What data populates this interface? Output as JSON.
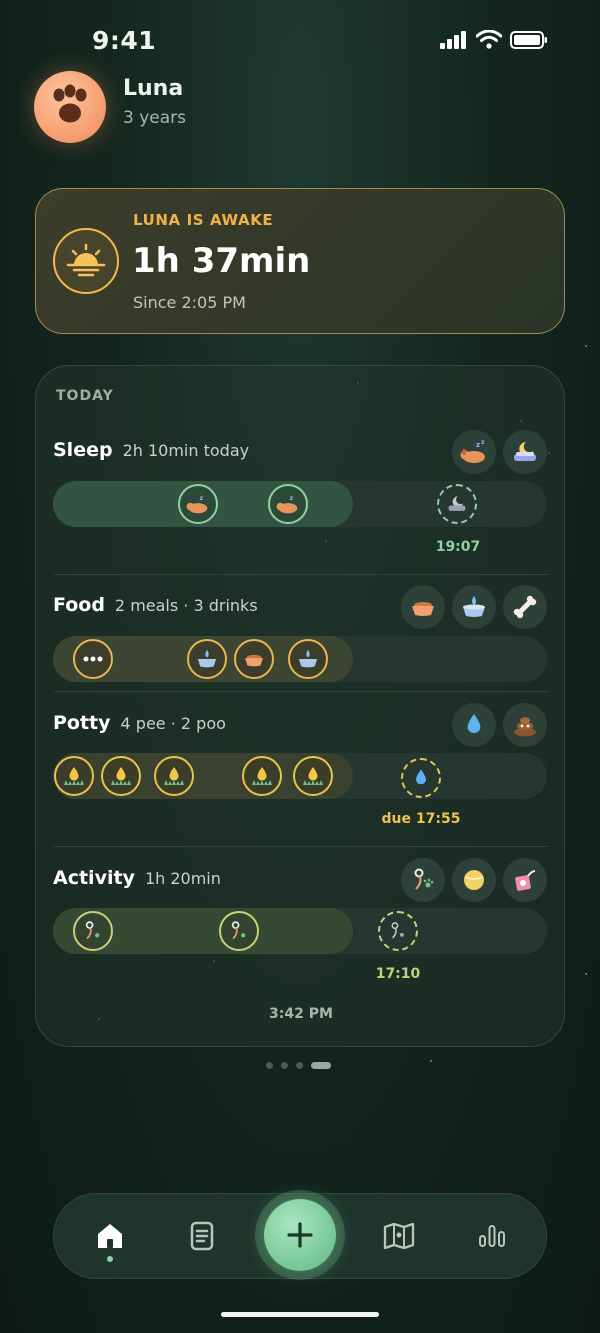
{
  "status_bar": {
    "time": "9:41"
  },
  "profile": {
    "name": "Luna",
    "age": "3 years"
  },
  "awake": {
    "label": "LUNA IS AWAKE",
    "duration": "1h 37min",
    "since": "Since 2:05 PM"
  },
  "today": {
    "label": "TODAY",
    "now_time": "3:42 PM",
    "sleep": {
      "title": "Sleep",
      "summary": "2h 10min today",
      "next_time": "19:07",
      "quick_actions": [
        "sleeping-dog-icon",
        "dog-bed-moon-icon"
      ]
    },
    "food": {
      "title": "Food",
      "summary": "2 meals · 3 drinks",
      "quick_actions": [
        "food-bowl-icon",
        "water-bowl-icon",
        "bone-icon"
      ]
    },
    "potty": {
      "title": "Potty",
      "summary": "4 pee · 2 poo",
      "due": "due 17:55",
      "quick_actions": [
        "pee-drop-icon",
        "poop-icon"
      ]
    },
    "activity": {
      "title": "Activity",
      "summary": "1h 20min",
      "next_time": "17:10",
      "quick_actions": [
        "leash-walk-icon",
        "ball-icon",
        "toy-icon"
      ]
    }
  },
  "pager": {
    "pages": 4,
    "active": 4
  },
  "tabbar": {
    "items": [
      "home-icon",
      "notes-icon",
      "add-icon",
      "map-icon",
      "stats-icon"
    ],
    "active": "home-icon"
  },
  "colors": {
    "accent_gold": "#f0b24a",
    "accent_green": "#8fd1a2",
    "background": "#14271f"
  }
}
